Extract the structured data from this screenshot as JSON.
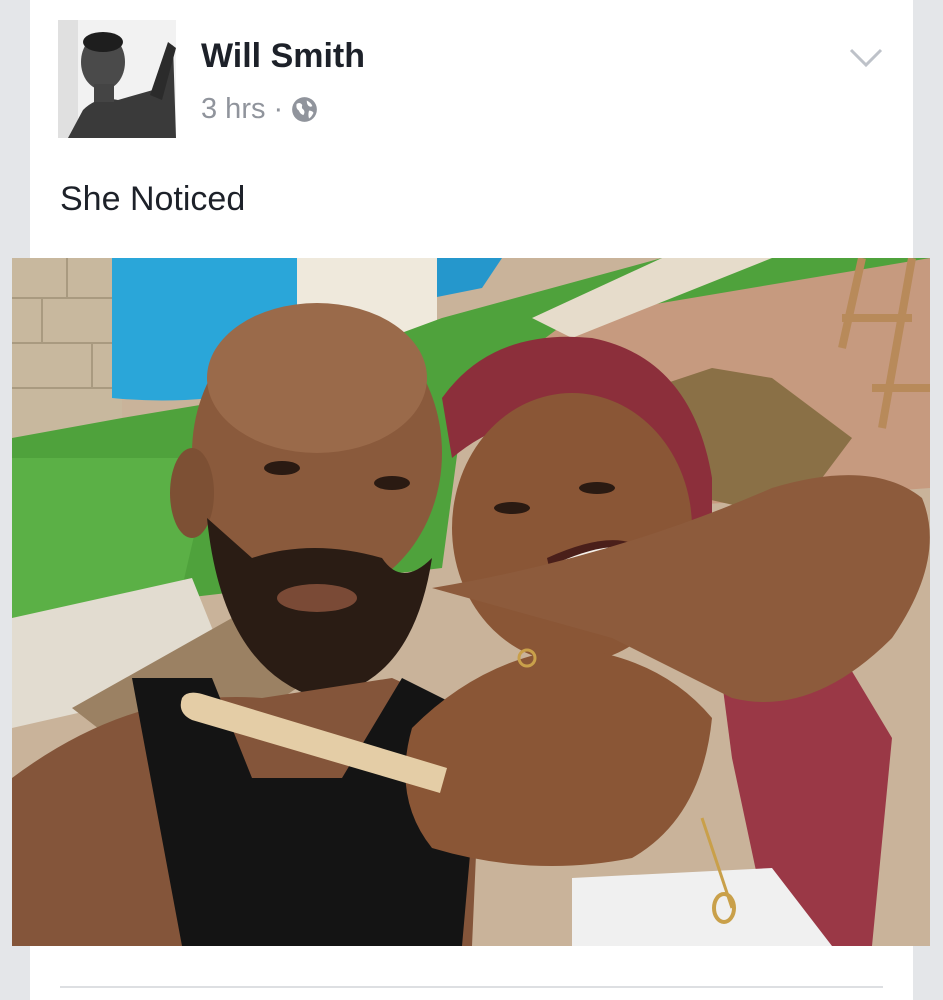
{
  "post": {
    "author": "Will Smith",
    "time": "3 hrs",
    "separator": "·",
    "privacy_icon": "globe-icon",
    "text": "She Noticed",
    "options_icon": "chevron-down-icon"
  },
  "colors": {
    "background": "#e9ebee",
    "card": "#ffffff",
    "name_text": "#1d2129",
    "meta_text": "#90949c"
  }
}
